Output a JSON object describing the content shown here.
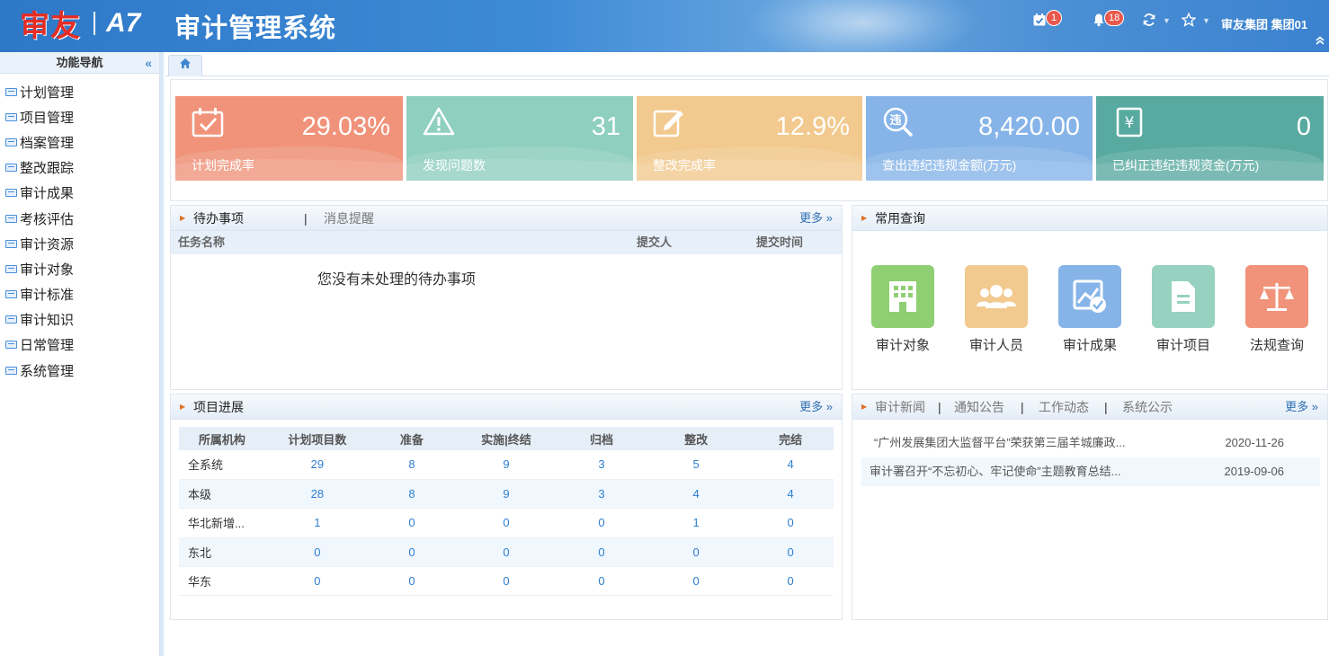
{
  "header": {
    "brand": "审友",
    "version": "A7",
    "system_name": "审计管理系统",
    "calendar_badge": "1",
    "bell_badge": "18",
    "user": "审友集团  集团01"
  },
  "sidebar": {
    "title": "功能导航",
    "items": [
      "计划管理",
      "项目管理",
      "档案管理",
      "整改跟踪",
      "审计成果",
      "考核评估",
      "审计资源",
      "审计对象",
      "审计标准",
      "审计知识",
      "日常管理",
      "系统管理"
    ]
  },
  "stats": [
    {
      "value": "29.03%",
      "label": "计划完成率",
      "color": "#f0937a",
      "icon": "calendar-check-icon"
    },
    {
      "value": "31",
      "label": "发现问题数",
      "color": "#8fcfbf",
      "icon": "warning-icon"
    },
    {
      "value": "12.9%",
      "label": "整改完成率",
      "color": "#f2c98e",
      "icon": "edit-icon"
    },
    {
      "value": "8,420.00",
      "label": "查出违纪违规金额(万元)",
      "color": "#86b4e8",
      "icon": "violation-search-icon"
    },
    {
      "value": "0",
      "label": "已纠正违纪违规资金(万元)",
      "color": "#58aaa0",
      "icon": "yuan-doc-icon"
    }
  ],
  "todo": {
    "title": "待办事项",
    "tab2": "消息提醒",
    "more": "更多 »",
    "columns": [
      "任务名称",
      "提交人",
      "提交时间"
    ],
    "empty": "您没有未处理的待办事项"
  },
  "query": {
    "title": "常用查询",
    "items": [
      {
        "label": "审计对象",
        "color": "#8fcf73",
        "icon": "building-icon"
      },
      {
        "label": "审计人员",
        "color": "#f2c98e",
        "icon": "people-icon"
      },
      {
        "label": "审计成果",
        "color": "#86b4e8",
        "icon": "result-chart-icon"
      },
      {
        "label": "审计项目",
        "color": "#96d2bf",
        "icon": "folder-icon"
      },
      {
        "label": "法规查询",
        "color": "#f0937a",
        "icon": "scale-icon"
      }
    ]
  },
  "progress": {
    "title": "项目进展",
    "more": "更多 »",
    "columns": [
      "所属机构",
      "计划项目数",
      "准备",
      "实施|终结",
      "归档",
      "整改",
      "完结"
    ],
    "rows": [
      [
        "全系统",
        "29",
        "8",
        "9",
        "3",
        "5",
        "4"
      ],
      [
        "本级",
        "28",
        "8",
        "9",
        "3",
        "4",
        "4"
      ],
      [
        "华北新增...",
        "1",
        "0",
        "0",
        "0",
        "1",
        "0"
      ],
      [
        "东北",
        "0",
        "0",
        "0",
        "0",
        "0",
        "0"
      ],
      [
        "华东",
        "0",
        "0",
        "0",
        "0",
        "0",
        "0"
      ]
    ]
  },
  "news": {
    "tabs": [
      "审计新闻",
      "通知公告",
      "工作动态",
      "系统公示"
    ],
    "more": "更多 »",
    "items": [
      {
        "title": "“广州发展集团大监督平台”荣获第三届羊城廉政...",
        "date": "2020-11-26"
      },
      {
        "title": "审计署召开“不忘初心、牢记使命”主题教育总结...",
        "date": "2019-09-06"
      }
    ]
  }
}
